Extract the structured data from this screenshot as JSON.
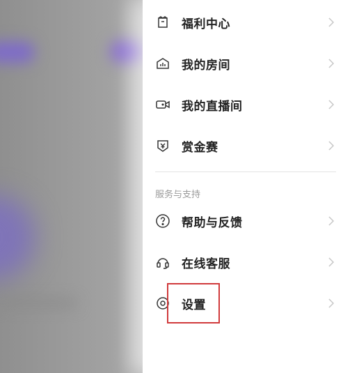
{
  "menu": {
    "items": [
      {
        "label": "福利中心",
        "icon": "gift-box-icon"
      },
      {
        "label": "我的房间",
        "icon": "room-icon"
      },
      {
        "label": "我的直播间",
        "icon": "camera-icon"
      },
      {
        "label": "赏金赛",
        "icon": "yuan-shield-icon"
      }
    ]
  },
  "support": {
    "title": "服务与支持",
    "items": [
      {
        "label": "帮助与反馈",
        "icon": "help-icon"
      },
      {
        "label": "在线客服",
        "icon": "headset-icon"
      },
      {
        "label": "设置",
        "icon": "settings-icon"
      }
    ]
  },
  "colors": {
    "highlight_border": "#d0393b",
    "text": "#222222",
    "muted": "#9a9a9a",
    "chevron": "#c8c8c8"
  }
}
